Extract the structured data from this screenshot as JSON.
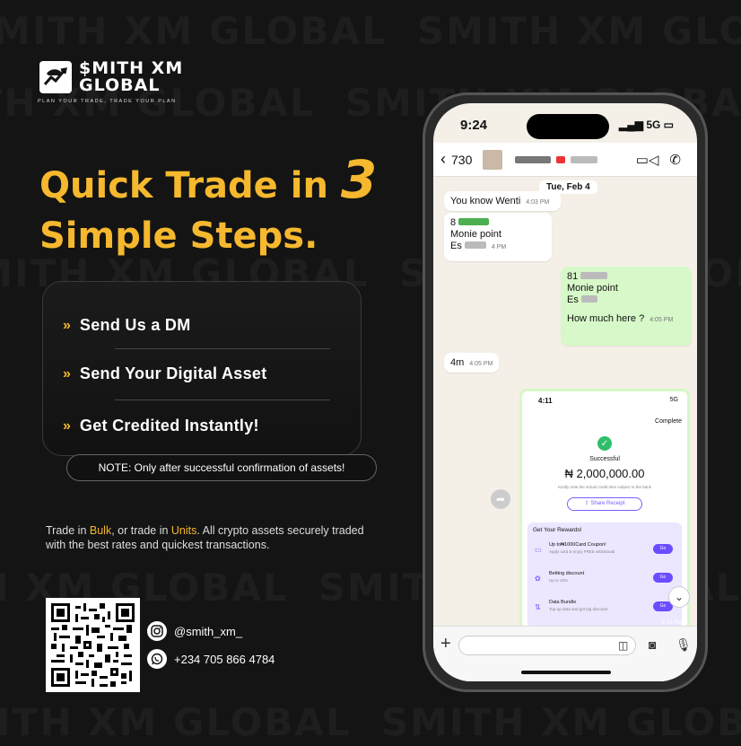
{
  "brand": {
    "name_line1": "$MITH XM",
    "name_line2": "GLOBAL",
    "tagline": "PLAN YOUR TRADE, TRADE YOUR PLAN",
    "watermark": "SMITH XM GLOBAL",
    "accent_color": "#f5b82e"
  },
  "headline": {
    "line1": "Quick Trade in",
    "number": "3",
    "line2": "Simple Steps."
  },
  "steps": [
    {
      "label": "Send Us a DM"
    },
    {
      "label": "Send Your Digital Asset"
    },
    {
      "label": "Get Credited Instantly!"
    }
  ],
  "note": "NOTE: Only after successful confirmation of assets!",
  "description": {
    "part1": "Trade in ",
    "bulk": "Bulk",
    "part2": ", or trade in ",
    "units": "Units",
    "part3": ". All crypto assets securely traded with the best rates and quickest transactions."
  },
  "contact": {
    "instagram": "@smith_xm_",
    "whatsapp": "+234 705 866 4784"
  },
  "phone": {
    "status_time": "9:24",
    "status_right": "5G",
    "chat_back_count": "730",
    "date_pill": "Tue, Feb 4",
    "messages": [
      {
        "text": "You know Wenti",
        "time": "4:03 PM",
        "dir": "in"
      },
      {
        "text_lines": [
          "8",
          "Monie point",
          "Es"
        ],
        "time": "4 PM",
        "dir": "in"
      },
      {
        "text_lines": [
          "81",
          "Monie point",
          "Es"
        ],
        "dir": "out"
      },
      {
        "text": "How much here ?",
        "time": "4:05 PM",
        "dir": "out"
      },
      {
        "text": "4m",
        "time": "4:05 PM",
        "dir": "in"
      }
    ],
    "receipt": {
      "time": "4:11",
      "network": "5G",
      "complete": "Complete",
      "status": "Successful",
      "amount": "₦ 2,000,000.00",
      "subtext": "Kindly note the actual credit time subject to the bank",
      "share": "Share Receipt",
      "rewards_title": "Get Your Rewards!",
      "rewards": [
        {
          "title": "Up to₦1000Card Coupon!",
          "sub": "Apply card & enjoy FREE withdrawal",
          "btn": "Go"
        },
        {
          "title": "Betting discount",
          "sub": "Up to 10%",
          "btn": "Go"
        },
        {
          "title": "Data Bundle",
          "sub": "Top-up data and get big discount",
          "btn": "Go"
        }
      ],
      "footer_time": "4:13 PM"
    }
  }
}
